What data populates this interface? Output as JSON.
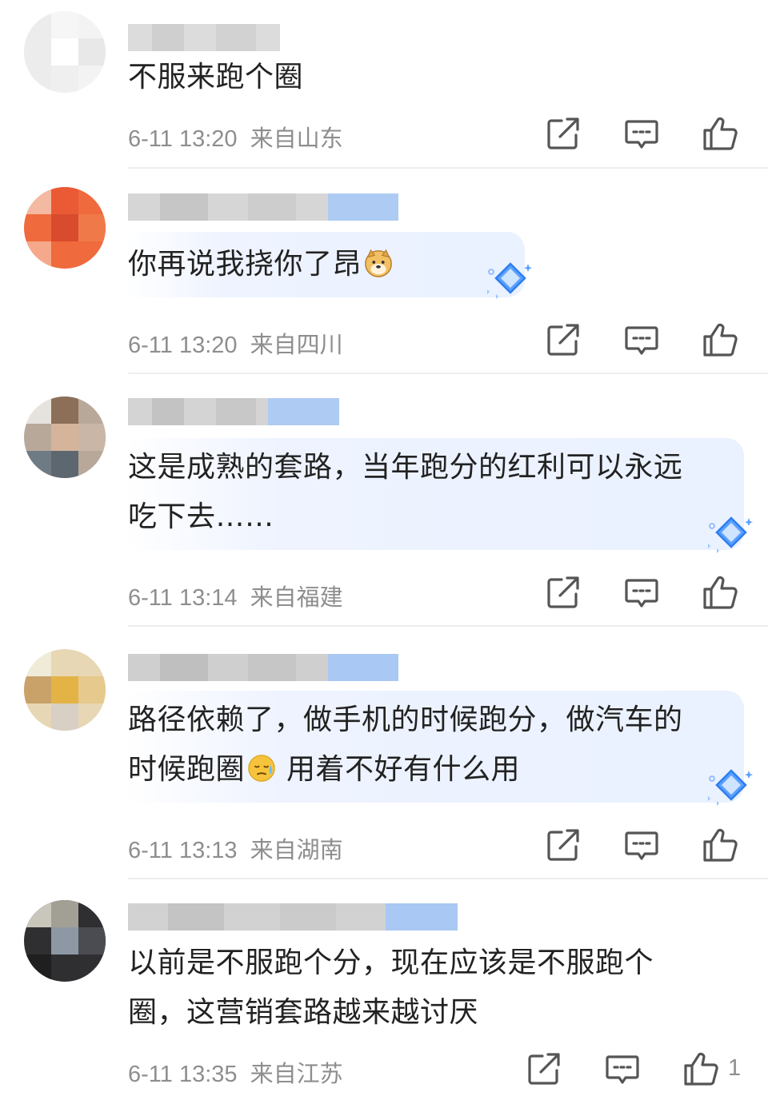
{
  "comments": [
    {
      "text": "不服来跑个圈",
      "time": "6-11 13:20",
      "location": "来自山东",
      "likes": ""
    },
    {
      "text": "你再说我挠你了昂",
      "time": "6-11 13:20",
      "location": "来自四川",
      "likes": "",
      "emoji": "doge-emoji"
    },
    {
      "text_line1": "这是成熟的套路，当年跑分的红利可以永远",
      "text_line2": "吃下去……",
      "time": "6-11 13:14",
      "location": "来自福建",
      "likes": ""
    },
    {
      "text_line1": "路径依赖了，做手机的时候跑分，做汽车的",
      "text_line2_a": "时候跑圈",
      "text_line2_b": "用着不好有什么用",
      "time": "6-11 13:13",
      "location": "来自湖南",
      "likes": "",
      "emoji": "sweat-emoji"
    },
    {
      "text_line1": "以前是不服跑个分，现在应该是不服跑个",
      "text_line2": "圈，这营销套路越来越讨厌",
      "time": "6-11 13:35",
      "location": "来自江苏",
      "likes": "1"
    }
  ],
  "icons": {
    "share": "share-icon",
    "reply": "reply-icon",
    "like": "thumbs-up-icon",
    "badge": "diamond-badge-icon"
  },
  "colors": {
    "text": "#222222",
    "meta": "#8e8e8e",
    "icon": "#555555",
    "bubble": "#eaf1ff",
    "badge": "#5aa0ff"
  }
}
